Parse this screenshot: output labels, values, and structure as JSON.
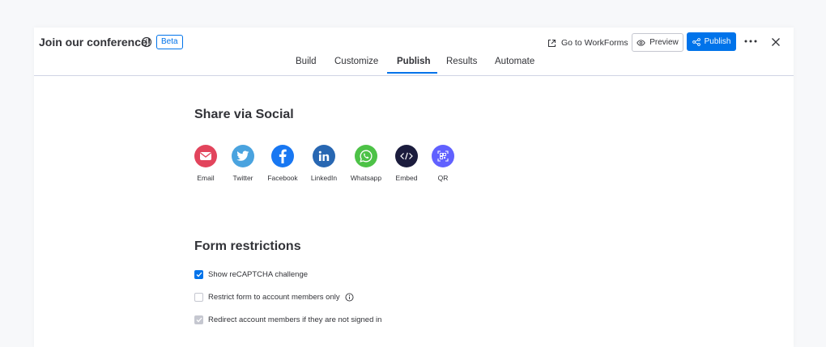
{
  "header": {
    "title": "Join our conference!",
    "beta_label": "Beta",
    "go_to_workforms": "Go to WorkForms",
    "preview_label": "Preview",
    "publish_label": "Publish"
  },
  "tabs": [
    {
      "label": "Build"
    },
    {
      "label": "Customize"
    },
    {
      "label": "Publish"
    },
    {
      "label": "Results"
    },
    {
      "label": "Automate"
    }
  ],
  "share": {
    "title": "Share via Social",
    "items": [
      {
        "label": "Email",
        "icon": "email-icon",
        "color": "#e2445c"
      },
      {
        "label": "Twitter",
        "icon": "twitter-icon",
        "color": "#4aa3df"
      },
      {
        "label": "Facebook",
        "icon": "facebook-icon",
        "color": "#1877f2"
      },
      {
        "label": "LinkedIn",
        "icon": "linkedin-icon",
        "color": "#2867b2"
      },
      {
        "label": "Whatsapp",
        "icon": "whatsapp-icon",
        "color": "#4dc247"
      },
      {
        "label": "Embed",
        "icon": "embed-icon",
        "color": "#1b1c3d"
      },
      {
        "label": "QR",
        "icon": "qr-icon",
        "color": "#6161ff"
      }
    ]
  },
  "restrictions": {
    "title": "Form restrictions",
    "options": [
      {
        "label": "Show reCAPTCHA challenge",
        "state": "checked"
      },
      {
        "label": "Restrict form to account members only",
        "state": "unchecked"
      },
      {
        "label": "Redirect account members if they are not signed in",
        "state": "checked-disabled"
      }
    ]
  },
  "colors": {
    "accent": "#0073ea",
    "text": "#323338",
    "border": "#d0d4e4"
  }
}
